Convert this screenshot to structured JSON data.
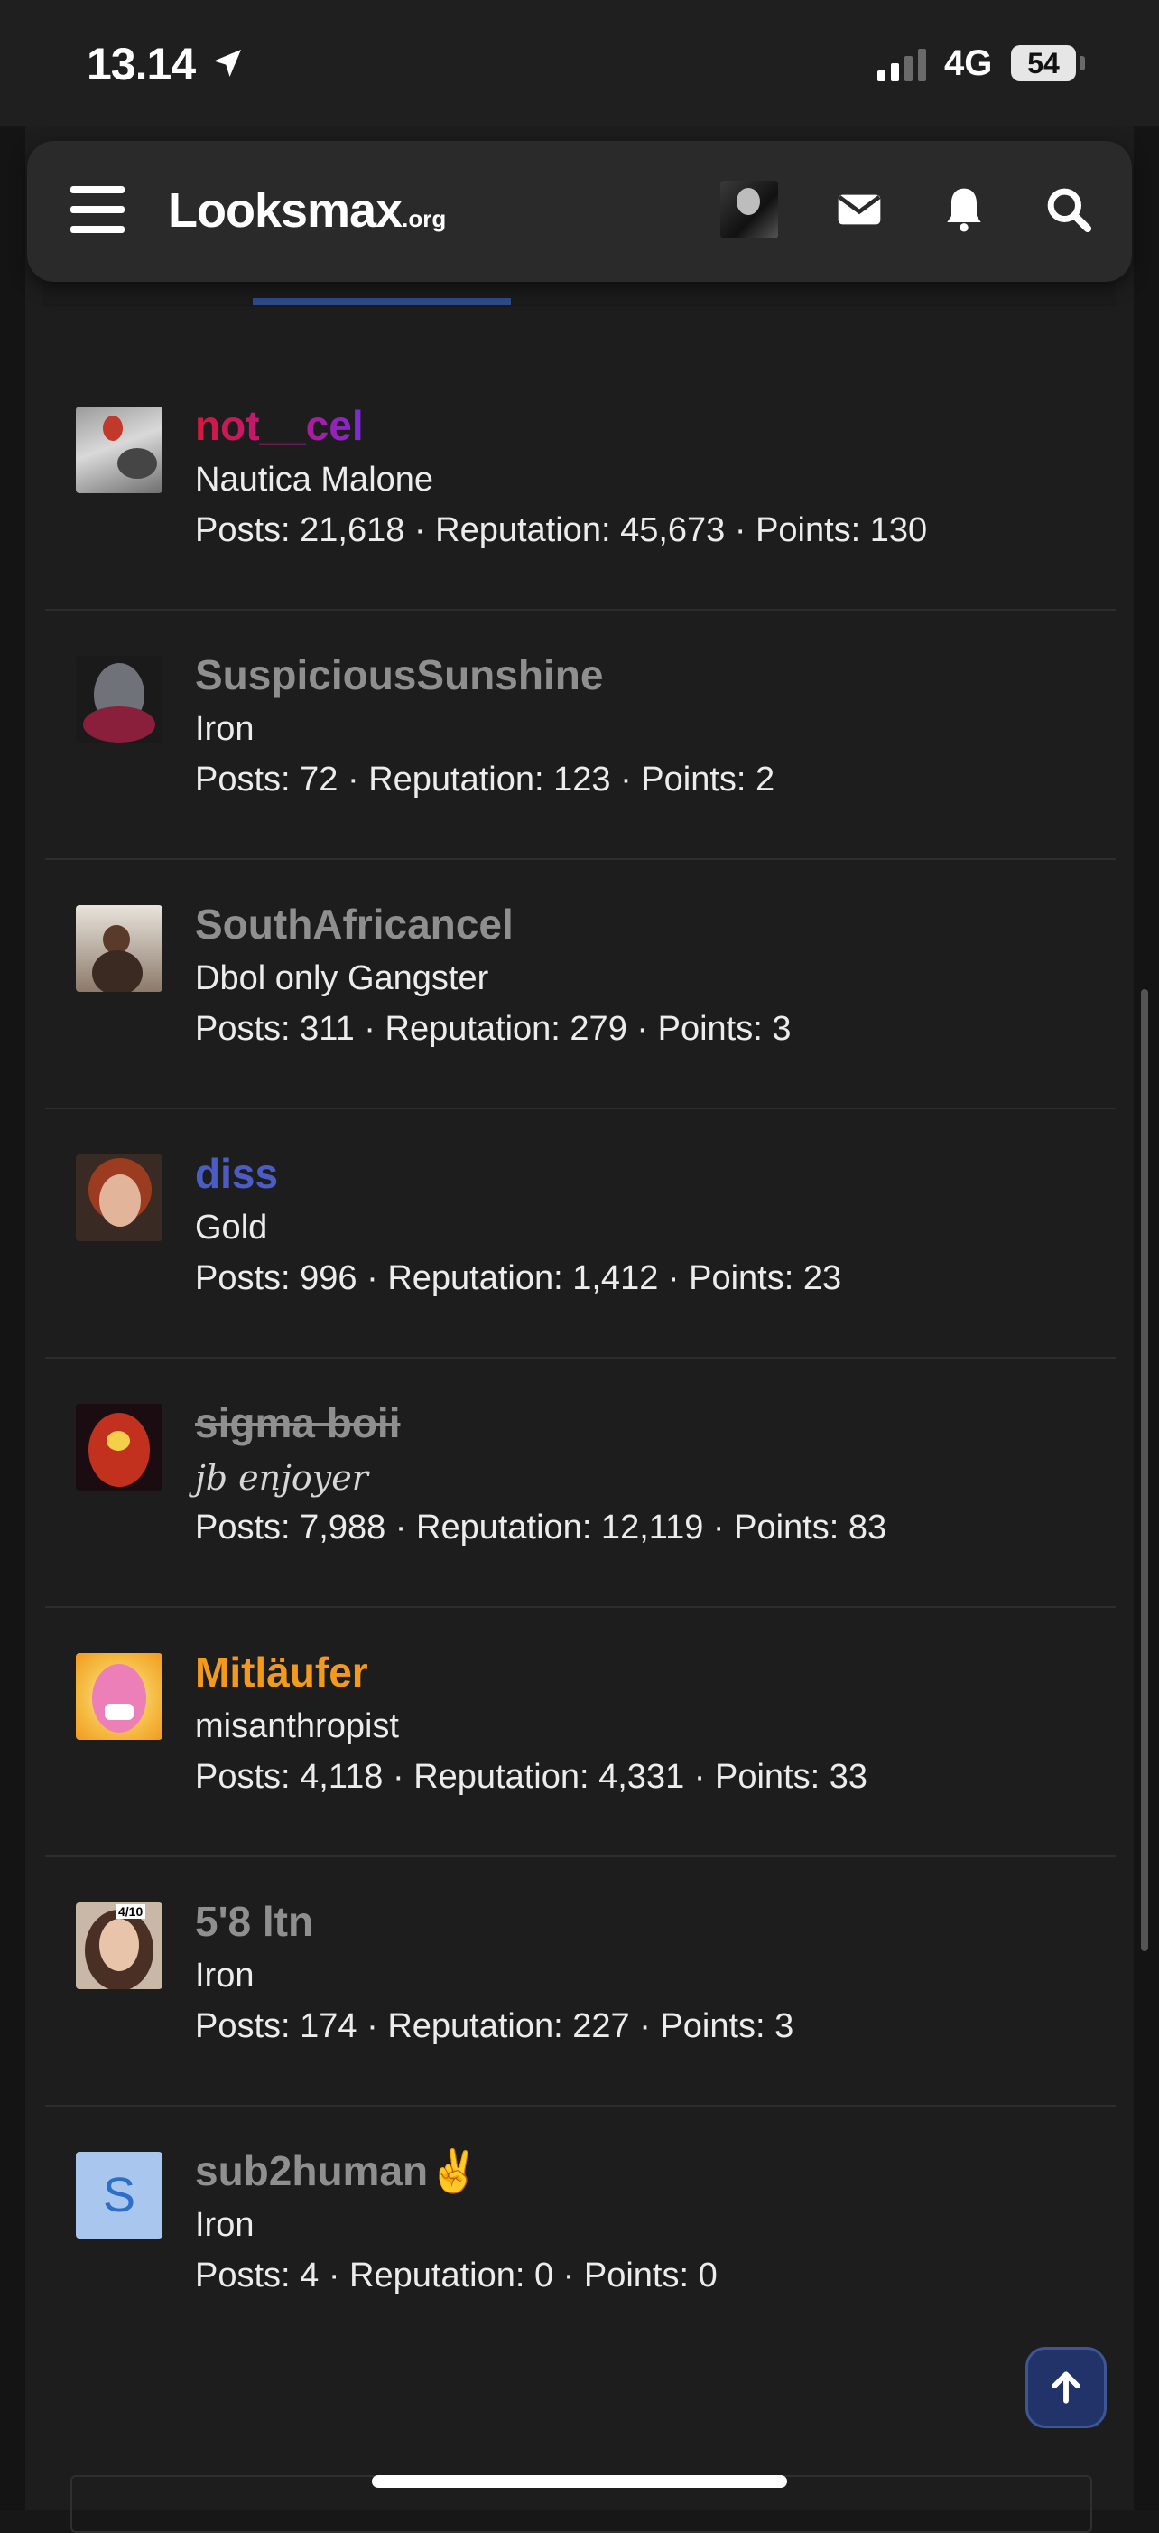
{
  "status": {
    "time": "13.14",
    "network": "4G",
    "battery": "54"
  },
  "navbar": {
    "logo_main": "Looksmax",
    "logo_tld": ".org"
  },
  "members": [
    {
      "name": "not__cel",
      "title": "Nautica Malone",
      "stats": "Posts: 21,618 · Reputation: 45,673 · Points: 130"
    },
    {
      "name": "SuspiciousSunshine",
      "title": "Iron",
      "stats": "Posts: 72 · Reputation: 123 · Points: 2"
    },
    {
      "name": "SouthAfricancel",
      "title": "Dbol only Gangster",
      "stats": "Posts: 311 · Reputation: 279 · Points: 3"
    },
    {
      "name": "diss",
      "title": "Gold",
      "stats": "Posts: 996 · Reputation: 1,412 · Points: 23"
    },
    {
      "name": "sigma boii",
      "title": "jb enjoyer",
      "stats": "Posts: 7,988 · Reputation: 12,119 · Points: 83"
    },
    {
      "name": "Mitläufer",
      "title": "misanthropist",
      "stats": "Posts: 4,118 · Reputation: 4,331 · Points: 33"
    },
    {
      "name": "5'8 ltn",
      "title": "Iron",
      "stats": "Posts: 174 · Reputation: 227 · Points: 3",
      "avatar_badge": "4/10"
    },
    {
      "name": "sub2human✌️",
      "title": "Iron",
      "stats": "Posts: 4 · Reputation: 0 · Points: 0",
      "avatar_letter": "S"
    }
  ],
  "colors": {
    "background": "#171717",
    "card": "#1d1d1d",
    "navbar": "#2a2a2a",
    "name_default": "#8f8f8f",
    "name_gold_member": "#4b5cc4",
    "name_orange": "#f39a1d",
    "accent_blue": "#22336a"
  },
  "icons": [
    "location-arrow-icon",
    "menu-icon",
    "mail-icon",
    "bell-icon",
    "search-icon",
    "arrow-up-icon"
  ]
}
